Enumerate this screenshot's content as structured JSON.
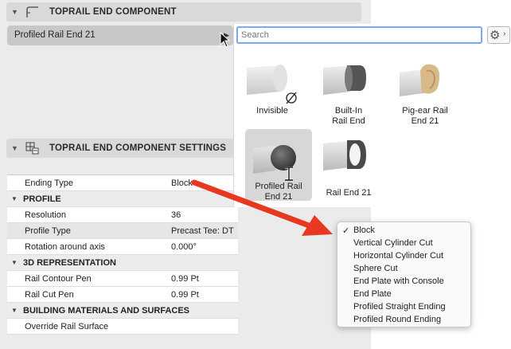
{
  "component_header": {
    "title": "TOPRAIL END COMPONENT",
    "icon": "rail-end-icon"
  },
  "selected_component": {
    "value": "Profiled Rail End 21"
  },
  "search": {
    "placeholder": "Search"
  },
  "settings_header": {
    "title": "TOPRAIL END COMPONENT SETTINGS",
    "icon": "settings-grid-icon"
  },
  "gallery": {
    "items": [
      {
        "label": "Invisible",
        "icon": "invisible-rail-end-icon"
      },
      {
        "label": "Built-In Rail End",
        "icon": "built-in-rail-end-icon"
      },
      {
        "label": "Pig-ear Rail End 21",
        "icon": "pig-ear-rail-end-icon"
      },
      {
        "label": "Profiled Rail End 21",
        "icon": "profiled-rail-end-icon",
        "selected": true
      },
      {
        "label": "Rail End 21",
        "icon": "rail-end-21-icon"
      }
    ]
  },
  "settings_rows": [
    {
      "label": "Ending Type",
      "value": "Block"
    },
    {
      "group": "PROFILE"
    },
    {
      "label": "Resolution",
      "value": "36"
    },
    {
      "label": "Profile Type",
      "value": "Precast Tee: DT"
    },
    {
      "label": "Rotation around axis",
      "value": "0.000°"
    },
    {
      "group": "3D REPRESENTATION"
    },
    {
      "label": "Rail Contour Pen",
      "value": "0.99 Pt"
    },
    {
      "label": "Rail Cut Pen",
      "value": "0.99 Pt"
    },
    {
      "group": "BUILDING MATERIALS AND SURFACES"
    },
    {
      "label": "Override Rail Surface",
      "value": ""
    }
  ],
  "ending_type_options": {
    "selected": "Block",
    "items": [
      "Block",
      "Vertical Cylinder Cut",
      "Horizontal Cylinder Cut",
      "Sphere Cut",
      "End Plate with Console",
      "End Plate",
      "Profiled Straight Ending",
      "Profiled Round Ending"
    ]
  },
  "colors": {
    "annotation_arrow": "#e8381f",
    "focus_ring": "#7aaaf0",
    "selected_tile": "#d7d7d7"
  }
}
